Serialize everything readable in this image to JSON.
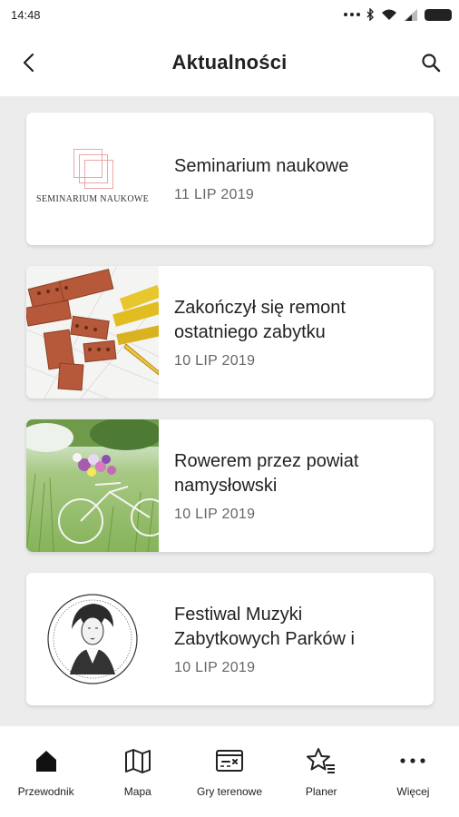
{
  "status_bar": {
    "time": "14:48"
  },
  "app_bar": {
    "title": "Aktualności",
    "back_icon": "chevron-left-icon",
    "search_icon": "search-icon"
  },
  "news": [
    {
      "title": "Seminarium naukowe",
      "date": "11 LIP 2019",
      "thumbnail": "seminar-logo",
      "thumbnail_caption": "SEMINARIUM NAUKOWE"
    },
    {
      "title": "Zakończył się remont\nostatniego zabytku",
      "date": "10 LIP 2019",
      "thumbnail": "bricks-photo"
    },
    {
      "title": "Rowerem przez powiat\nnamysłowski",
      "date": "10 LIP 2019",
      "thumbnail": "bicycle-photo"
    },
    {
      "title": "Festiwal Muzyki\nZabytkowych Parków i",
      "date": "10 LIP 2019",
      "thumbnail": "festival-logo"
    }
  ],
  "bottom_nav": [
    {
      "label": "Przewodnik",
      "icon": "home-icon",
      "active": true
    },
    {
      "label": "Mapa",
      "icon": "map-icon"
    },
    {
      "label": "Gry terenowe",
      "icon": "ticket-icon"
    },
    {
      "label": "Planer",
      "icon": "star-list-icon"
    },
    {
      "label": "Więcej",
      "icon": "more-dots-icon"
    }
  ],
  "colors": {
    "accent": "#222222",
    "background": "#ececec",
    "card": "#ffffff",
    "muted_text": "#666666"
  }
}
